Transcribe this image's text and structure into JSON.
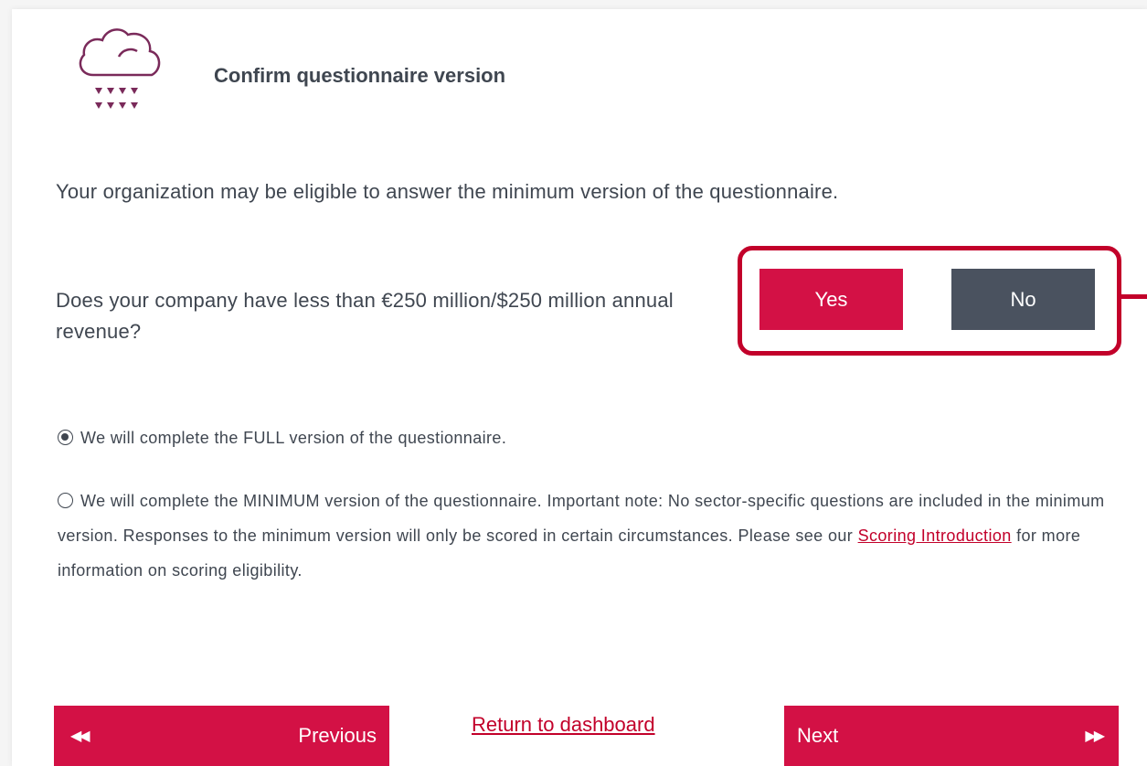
{
  "header": {
    "title": "Confirm questionnaire version",
    "logo_icon": "cloud-rain-icon"
  },
  "intro_text": "Your organization may be eligible to answer the minimum version of the questionnaire.",
  "question": {
    "text": "Does your company have less than €250 million/$250 million annual revenue?",
    "yes_label": "Yes",
    "no_label": "No"
  },
  "options": {
    "full": {
      "text": "We will complete the FULL version of the questionnaire.",
      "selected": true
    },
    "minimum": {
      "text_before": "We will complete the MINIMUM version of the questionnaire. Important note: No sector-specific questions are included in the minimum version. Responses to the minimum version will only be scored in certain circumstances. Please see our ",
      "link_text": "Scoring Introduction",
      "text_after": " for more information on scoring eligibility.",
      "selected": false
    }
  },
  "navigation": {
    "previous_label": "Previous",
    "previous_arrow": "◀◀",
    "next_label": "Next",
    "next_arrow": "▶▶",
    "return_label": "Return to dashboard"
  },
  "colors": {
    "accent": "#d31145",
    "highlight": "#c2002a",
    "dark_button": "#4a525f",
    "text": "#3f4650",
    "logo": "#7a2a5a"
  }
}
